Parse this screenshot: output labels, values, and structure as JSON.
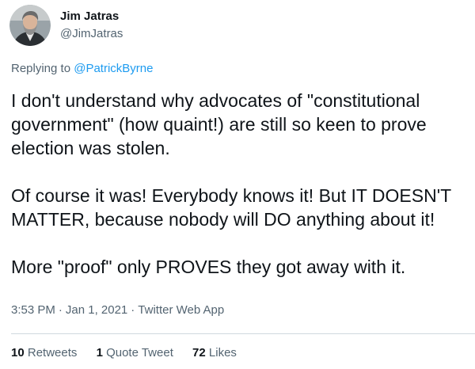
{
  "tweet": {
    "author": {
      "name": "Jim Jatras",
      "handle": "@JimJatras"
    },
    "replying_prefix": "Replying to",
    "replying_to": "@PatrickByrne",
    "paragraphs": [
      "I don't understand why advocates of \"constitutional government\" (how quaint!) are still so keen to prove election was stolen.",
      "Of course it was! Everybody knows it! But IT DOESN'T MATTER, because nobody will DO anything about it!",
      "More \"proof\" only PROVES they got away with it."
    ],
    "time": "3:53 PM",
    "date": "Jan 1, 2021",
    "source": "Twitter Web App",
    "separator": "·",
    "stats": {
      "retweets_count": "10",
      "retweets_label": "Retweets",
      "quotes_count": "1",
      "quotes_label": "Quote Tweet",
      "likes_count": "72",
      "likes_label": "Likes"
    }
  },
  "colors": {
    "text": "#0f1419",
    "secondary": "#536471",
    "link": "#1d9bf0",
    "divider": "#cfd9de"
  }
}
